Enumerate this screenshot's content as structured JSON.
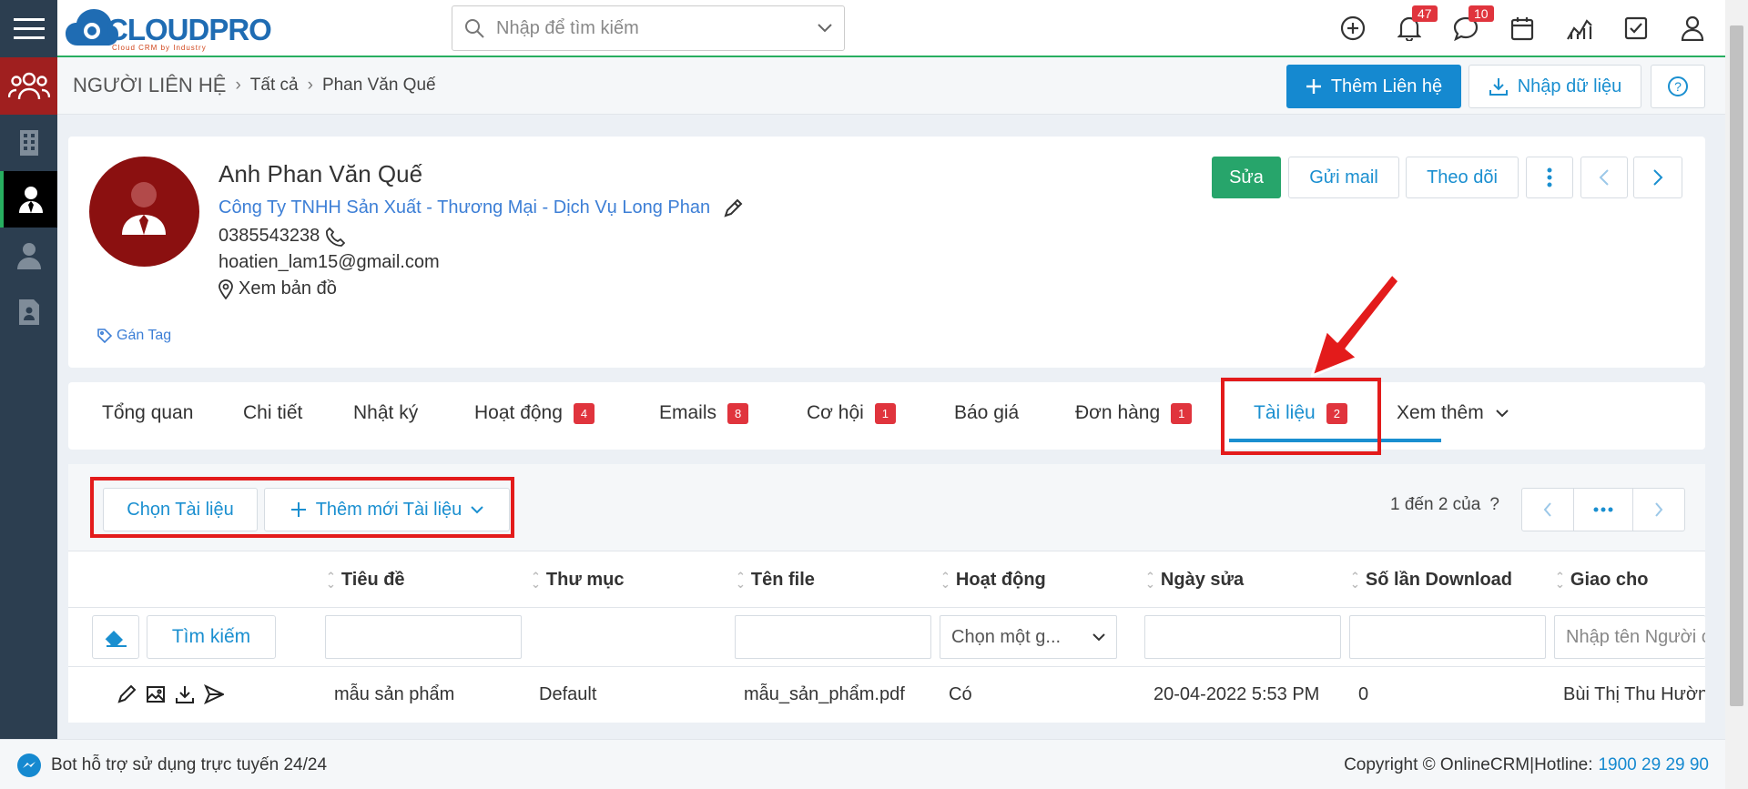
{
  "topbar": {
    "logo_text": "CLOUDPRO",
    "logo_sub": "Cloud CRM by Industry",
    "search_placeholder": "Nhập để tìm kiếm",
    "notification_count": "47",
    "chat_count": "10"
  },
  "breadcrumb": {
    "module": "NGƯỜI LIÊN HỆ",
    "level1": "Tất cả",
    "current": "Phan Văn Quế"
  },
  "actions": {
    "add_contact": "Thêm Liên hệ",
    "import_data": "Nhập dữ liệu",
    "help": "?"
  },
  "profile": {
    "name": "Anh Phan Văn Quế",
    "company": "Công Ty TNHH Sản Xuất - Thương Mại - Dịch Vụ Long Phan",
    "phone": "0385543238",
    "email": "hoatien_lam15@gmail.com",
    "map": "Xem bản đồ",
    "tag": "Gán Tag",
    "btn_edit": "Sửa",
    "btn_mail": "Gửi mail",
    "btn_follow": "Theo dõi"
  },
  "tabs": [
    {
      "label": "Tổng quan",
      "badge": ""
    },
    {
      "label": "Chi tiết",
      "badge": ""
    },
    {
      "label": "Nhật ký",
      "badge": ""
    },
    {
      "label": "Hoạt động",
      "badge": "4"
    },
    {
      "label": "Emails",
      "badge": "8"
    },
    {
      "label": "Cơ hội",
      "badge": "1"
    },
    {
      "label": "Báo giá",
      "badge": ""
    },
    {
      "label": "Đơn hàng",
      "badge": "1"
    },
    {
      "label": "Tài liệu",
      "badge": "2"
    },
    {
      "label": "Xem thêm",
      "badge": ""
    }
  ],
  "docs": {
    "choose": "Chọn Tài liệu",
    "add_new": "Thêm mới Tài liệu",
    "paging": "1 đến 2 của",
    "paging_q": "?",
    "columns": [
      "Tiêu đề",
      "Thư mục",
      "Tên file",
      "Hoạt động",
      "Ngày sửa",
      "Số lần Download",
      "Giao cho"
    ],
    "search_btn": "Tìm kiếm",
    "select_placeholder": "Chọn một g...",
    "assignee_placeholder": "Nhập tên Người c",
    "row": {
      "title": "mẫu sản phẩm",
      "folder": "Default",
      "file": "mẫu_sản_phẩm.pdf",
      "active": "Có",
      "modified": "20-04-2022 5:53 PM",
      "downloads": "0",
      "assignee": "Bùi Thị Thu Hườn"
    }
  },
  "footer": {
    "bot": "Bot hỗ trợ sử dụng trực tuyến 24/24",
    "copyright": "Copyright © OnlineCRM|Hotline:",
    "hotline": "1900 29 29 90"
  },
  "colors": {
    "brand": "#1589d0",
    "success": "#27a56b",
    "badge": "#e0343d",
    "sidebar": "#2c3e50",
    "annotation": "#e31b1b"
  }
}
